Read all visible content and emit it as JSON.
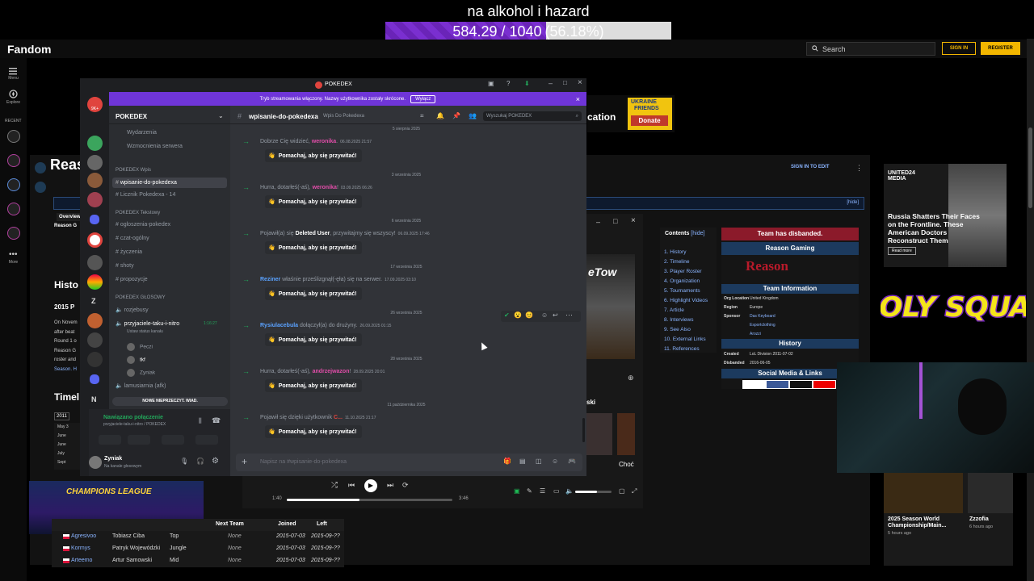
{
  "overlay": {
    "title": "na alkohol i hazard",
    "progress_text": "584.29 / 1040",
    "progress_pct_text": "(56.18%)",
    "progress_fraction": 0.5618
  },
  "fandom": {
    "logo": "Fandom",
    "search_placeholder": "Search",
    "sign_in": "SIGN IN",
    "register": "REGISTER",
    "rail": [
      "Menu",
      "Explore",
      "RECENT",
      "More"
    ],
    "page_title_fragment": "Reas",
    "section_history": "Histo",
    "section_2015": "2015 P",
    "section_timeline": "Timel",
    "sign_in_to_edit": "SIGN IN TO EDIT",
    "hide": "[hide]",
    "article_fragments": [
      "On Novem",
      "after beat",
      "Round 1 o",
      "Reason G",
      "roster and",
      "Season. H"
    ],
    "timeline_year": "2011",
    "timeline_months": [
      "May 3",
      "June",
      "June",
      "July",
      "Sept"
    ],
    "tabs": [
      "Overview",
      "Reason G"
    ],
    "toc": {
      "title": "Contents",
      "hide": "[hide]",
      "items": [
        "1. History",
        "2. Timeline",
        "3. Player Roster",
        "4. Organization",
        "5. Tournaments",
        "6. Highlight Videos",
        "7. Article",
        "8. Interviews",
        "9. See Also",
        "10. External Links",
        "11. References"
      ]
    },
    "infobox": {
      "disbanded": "Team has disbanded.",
      "name": "Reason Gaming",
      "logo_text": "Reason",
      "team_info": "Team Information",
      "org_location_label": "Org Location",
      "org_location": "United Kingdom",
      "region_label": "Region",
      "region": "Europe",
      "sponsor_label": "Sponsor",
      "sponsors": [
        "Das Keyboard",
        "Esportclothing",
        "Arozzi"
      ],
      "history": "History",
      "created_label": "Created",
      "created": "LoL Division 2011-07-02",
      "disbanded_label": "Disbanded",
      "disbanded_date": "2016-06-05",
      "social": "Social Media & Links"
    },
    "ad_ukraine": {
      "line1": "UKRAINE",
      "line2": "FRIENDS",
      "donate": "Donate",
      "cation": "cation"
    },
    "ad_united": {
      "brand": "UNITED24 MEDIA",
      "headline": "Russia Shatters Their Faces on the Frontline. These American Doctors Reconstruct Them",
      "cta": "Read more"
    },
    "holy_squad": "HOLY SQUAD",
    "news": [
      {
        "title": "2025 Season World Championship/Main...",
        "age": "5 hours ago"
      },
      {
        "title": "Zzzofia",
        "age": "6 hours ago"
      }
    ],
    "table": {
      "headers": [
        "Next Team",
        "Joined",
        "Left"
      ],
      "rows": [
        {
          "id": "Agresivoo",
          "name": "Tobiasz Ciba",
          "role": "Top",
          "next": "None",
          "joined": "2015-07-03",
          "left": "2015-09-??"
        },
        {
          "id": "Kormys",
          "name": "Patryk Wojewódzki",
          "role": "Jungle",
          "next": "None",
          "joined": "2015-07-03",
          "left": "2015-09-??"
        },
        {
          "id": "Arteemo",
          "name": "Artur Samowski",
          "role": "Mid",
          "next": "None",
          "joined": "2015-07-03",
          "left": "2015-09-??"
        }
      ]
    },
    "champions_league": "CHAMPIONS LEAGUE"
  },
  "player": {
    "text_tow": "eTow",
    "ski": "ski",
    "choc": "Choć",
    "time_current": "1:40",
    "time_total": "3:46",
    "progress_fraction": 0.44,
    "volume_fraction": 0.6
  },
  "discord": {
    "window_title": "POKEDEX",
    "streaming_banner": "Tryb streamowania włączony. Nazwy użytkownika zostały skrócone.",
    "streaming_off": "Wyłącz",
    "server_name": "POKEDEX",
    "channel_header": "wpisanie-do-pokedexa",
    "channel_topic": "Wpis Do Pokedexa",
    "search_placeholder": "Wyszukaj POKEDEX",
    "top_items": [
      "Wydarzenia",
      "Wzmocnienia serwera"
    ],
    "cat_wpis": "POKEDEX Wpis",
    "wpis_channels": [
      "wpisanie-do-pokedexa",
      "Licznik Pokedexa - 14"
    ],
    "cat_tekstowy": "POKEDEX Tekstowy",
    "text_channels": [
      "ogloszenia-pokedex",
      "czat-ogólny",
      "życzenia",
      "shoty",
      "propozycje"
    ],
    "cat_glosowy": "POKEDEX GŁOSOWY",
    "voice_channels": [
      "rozjebusy",
      "przyjaciele-taku-i-nitro",
      "lamusiarnia (afk)"
    ],
    "voice_timer": "1:16:27",
    "voice_status": "Ustaw status kanału",
    "voice_users": [
      "Peczi",
      "tkf",
      "Zyniak"
    ],
    "new_unread": "NOWE NIEPRZECZYT. WIAD.",
    "connection_title": "Nawiązano połączenie",
    "connection_sub": "przyjaciele-taku-i-nitro / POKEDEX",
    "user_name": "Zyniak",
    "user_status": "Na kanale głosowym",
    "composer_placeholder": "Napisz na #wpisanie-do-pokedexa",
    "server_badges": [
      "9K+",
      "6",
      "21",
      "2",
      "103",
      "263",
      "20"
    ],
    "server_letters": [
      "Z",
      "N"
    ],
    "wave_label": "Pomachaj, aby się przywitać!",
    "messages": [
      {
        "date": "5 sierpnia 2025",
        "pre": "Dobrze Cię widzieć, ",
        "user": "weronika",
        "post": ".",
        "time": "06.08.2025 21:57",
        "color": "#e04da8"
      },
      {
        "date": "3 września 2025",
        "pre": "Hurra, dotarłeś(-aś), ",
        "user": "weronika",
        "post": "!",
        "time": "03.09.2025 06:26",
        "color": "#e04da8"
      },
      {
        "date": "6 września 2025",
        "pre": "Pojawił(a) się ",
        "user": "Deleted User",
        "post": ", przywitajmy się wszyscy!",
        "time": "06.09.2025 17:46",
        "color": "#ffffff"
      },
      {
        "date": "17 września 2025",
        "pre": "",
        "user": "Reziner",
        "post": " właśnie prześlizgnął(-ęła) się na serwer.",
        "time": "17.09.2025 03:10",
        "color": "#5aa2ff"
      },
      {
        "date": "26 września 2025",
        "pre": "",
        "user": "Rysiulacebula",
        "post": " dołączył(a) do drużyny.",
        "time": "26.09.2025 01:15",
        "color": "#5aa2ff"
      },
      {
        "date": "28 września 2025",
        "pre": "Hurra, dotarłeś(-aś), ",
        "user": "andrzejwazon",
        "post": "!",
        "time": "28.09.2025 20:01",
        "color": "#e04da8"
      },
      {
        "date": "11 października 2025",
        "pre": "Pojawił się dzięki użytkownik ",
        "user": "C...",
        "post": "",
        "time": "11.10.2025 21:17",
        "color": "#e0443e"
      }
    ]
  }
}
